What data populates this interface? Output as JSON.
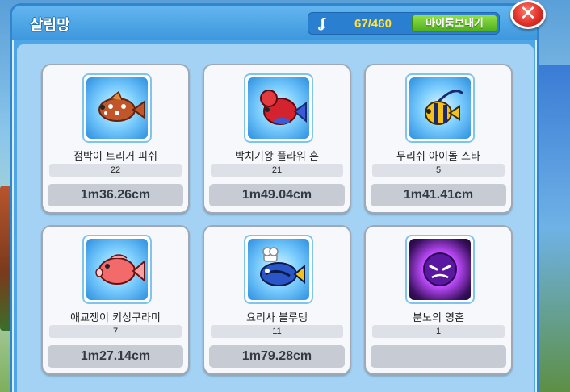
{
  "window": {
    "title": "살림망",
    "counter": "67/460",
    "send_label": "마이룸보내기",
    "close_label": "✕"
  },
  "fish": [
    {
      "name": "점박이 트리거 피쉬",
      "count": "22",
      "size": "1m36.26cm",
      "icon": "spotted-trigger-fish-icon"
    },
    {
      "name": "박치기왕 플라워 혼",
      "count": "21",
      "size": "1m49.04cm",
      "icon": "flowerhorn-fish-icon"
    },
    {
      "name": "무리쉬 아이돌 스타",
      "count": "5",
      "size": "1m41.41cm",
      "icon": "moorish-idol-fish-icon"
    },
    {
      "name": "애교쟁이 키싱구라미",
      "count": "7",
      "size": "1m27.14cm",
      "icon": "kissing-gourami-fish-icon"
    },
    {
      "name": "요리사 블루탱",
      "count": "11",
      "size": "1m79.28cm",
      "icon": "chef-blue-tang-fish-icon"
    },
    {
      "name": "분노의 영혼",
      "count": "1",
      "size": "",
      "icon": "rage-spirit-icon"
    }
  ],
  "colors": {
    "accent": "#3f98dd",
    "counter_text": "#ffe23a",
    "send_button": "#4fae1c",
    "close_button": "#e0312a"
  }
}
